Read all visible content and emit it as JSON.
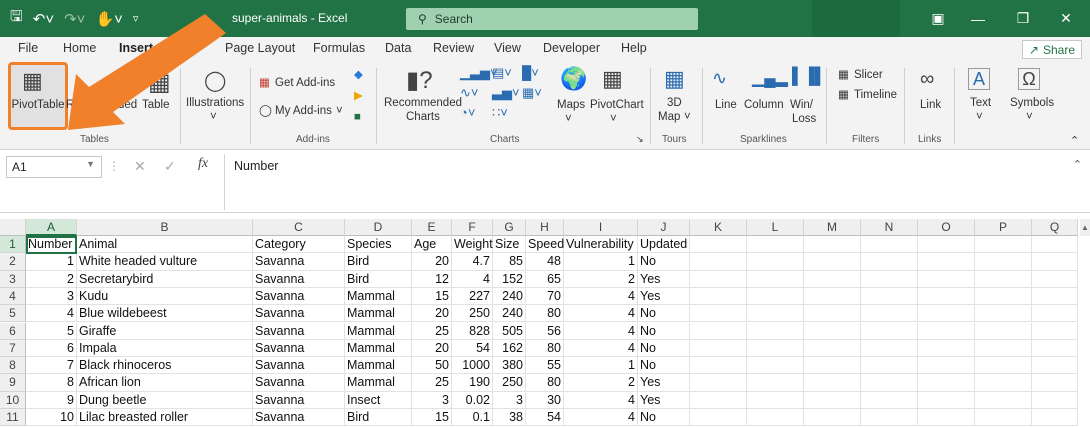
{
  "titlebar": {
    "doc_title": "super-animals  -  Excel",
    "search_placeholder": "Search"
  },
  "menu": {
    "tabs": [
      "File",
      "Home",
      "Insert",
      "Page Layout",
      "Formulas",
      "Data",
      "Review",
      "View",
      "Developer",
      "Help"
    ],
    "active": "Insert",
    "share": "Share"
  },
  "ribbon": {
    "tables": {
      "pivot": "PivotTable",
      "recommended_1": "Rec",
      "recommended_2": "ded",
      "recommended_3": "Pivo",
      "table": "Table",
      "group": "Tables"
    },
    "illustrations": {
      "label": "Illustrations"
    },
    "addins": {
      "get": "Get Add-ins",
      "my": "My Add-ins",
      "group": "Add-ins"
    },
    "charts": {
      "recommended_1": "Recommended",
      "recommended_2": "Charts",
      "maps": "Maps",
      "pivotchart": "PivotChart",
      "group": "Charts"
    },
    "tours": {
      "map_1": "3D",
      "map_2": "Map",
      "group": "Tours"
    },
    "sparklines": {
      "line": "Line",
      "column": "Column",
      "winloss_1": "Win/",
      "winloss_2": "Loss",
      "group": "Sparklines"
    },
    "filters": {
      "slicer": "Slicer",
      "timeline": "Timeline",
      "group": "Filters"
    },
    "links": {
      "link": "Link",
      "group": "Links"
    },
    "text": {
      "label": "Text"
    },
    "symbols": {
      "label": "Symbols"
    }
  },
  "formula_bar": {
    "cell_ref": "A1",
    "content": "Number"
  },
  "sheet": {
    "column_letters": [
      "A",
      "B",
      "C",
      "D",
      "E",
      "F",
      "G",
      "H",
      "I",
      "J",
      "K",
      "L",
      "M",
      "N",
      "O",
      "P",
      "Q"
    ],
    "headers": [
      "Number",
      "Animal",
      "Category",
      "Species",
      "Age",
      "Weight",
      "Size",
      "Speed",
      "Vulnerability",
      "Updated"
    ],
    "rows": [
      [
        "1",
        "White headed vulture",
        "Savanna",
        "Bird",
        "20",
        "4.7",
        "85",
        "48",
        "1",
        "No"
      ],
      [
        "2",
        "Secretarybird",
        "Savanna",
        "Bird",
        "12",
        "4",
        "152",
        "65",
        "2",
        "Yes"
      ],
      [
        "3",
        "Kudu",
        "Savanna",
        "Mammal",
        "15",
        "227",
        "240",
        "70",
        "4",
        "Yes"
      ],
      [
        "4",
        "Blue wildebeest",
        "Savanna",
        "Mammal",
        "20",
        "250",
        "240",
        "80",
        "4",
        "No"
      ],
      [
        "5",
        "Giraffe",
        "Savanna",
        "Mammal",
        "25",
        "828",
        "505",
        "56",
        "4",
        "No"
      ],
      [
        "6",
        "Impala",
        "Savanna",
        "Mammal",
        "20",
        "54",
        "162",
        "80",
        "4",
        "No"
      ],
      [
        "7",
        "Black rhinoceros",
        "Savanna",
        "Mammal",
        "50",
        "1000",
        "380",
        "55",
        "1",
        "No"
      ],
      [
        "8",
        "African lion",
        "Savanna",
        "Mammal",
        "25",
        "190",
        "250",
        "80",
        "2",
        "Yes"
      ],
      [
        "9",
        "Dung beetle",
        "Savanna",
        "Insect",
        "3",
        "0.02",
        "3",
        "30",
        "4",
        "Yes"
      ],
      [
        "10",
        "Lilac breasted roller",
        "Savanna",
        "Bird",
        "15",
        "0.1",
        "38",
        "54",
        "4",
        "No"
      ]
    ],
    "row_numbers": [
      "1",
      "2",
      "3",
      "4",
      "5",
      "6",
      "7",
      "8",
      "9",
      "10",
      "11"
    ]
  },
  "colors": {
    "excel_green": "#217346",
    "highlight_orange": "#f0802a"
  }
}
